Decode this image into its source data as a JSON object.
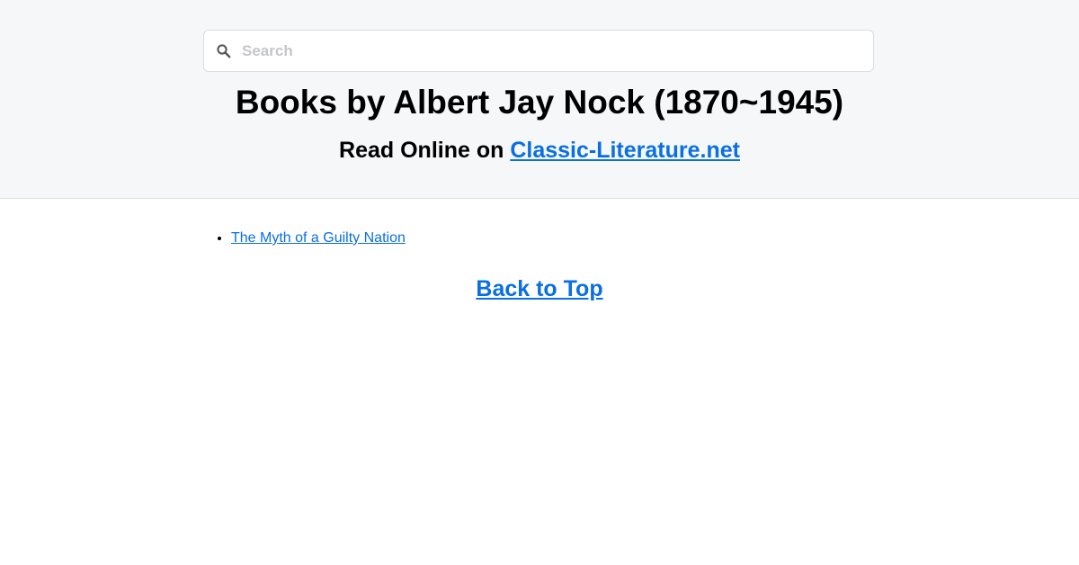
{
  "search": {
    "placeholder": "Search",
    "value": "",
    "icon": "search-icon"
  },
  "header": {
    "title": "Books by Albert Jay Nock (1870~1945)",
    "subtitle_prefix": "Read Online on ",
    "site_link_label": "Classic-Literature.net"
  },
  "books": [
    {
      "title": "The Myth of a Guilty Nation"
    }
  ],
  "footer": {
    "back_to_top_label": "Back to Top"
  },
  "colors": {
    "link": "#0a6fe0",
    "header_background": "#f6f7f9",
    "page_background": "#ffffff"
  }
}
